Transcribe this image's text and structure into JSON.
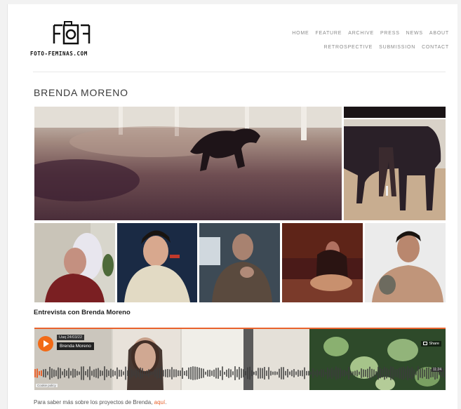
{
  "site": {
    "name": "FOTO-FEMINAS.COM",
    "logo_icon": "camera-letters-logo"
  },
  "nav": {
    "row1": [
      "HOME",
      "FEATURE",
      "ARCHIVE",
      "PRESS",
      "NEWS",
      "ABOUT"
    ],
    "row2": [
      "RETROSPECTIVE",
      "SUBMISSION",
      "CONTACT"
    ]
  },
  "page": {
    "title": "BRENDA MORENO"
  },
  "gallery": {
    "items": [
      "horse-galloping-photo",
      "horse-strip-photo",
      "horse-standing-photo",
      "woman-white-hair-portrait",
      "woman-sweater-portrait",
      "man-smoking-portrait",
      "woman-red-room-portrait",
      "tattooed-man-portrait"
    ]
  },
  "interview": {
    "title": "Entrevista con Brenda Moreno"
  },
  "player": {
    "accent_color": "#e8622c",
    "uploader": "Uaq 24/03/22",
    "track": "Brenda Moreno",
    "share_label": "Share",
    "time": "11:24",
    "cookie_label": "Cookie policy"
  },
  "footer_text": {
    "prefix": "Para saber más sobre los proyectos de Brenda, ",
    "link": "aquí",
    "suffix": "."
  }
}
